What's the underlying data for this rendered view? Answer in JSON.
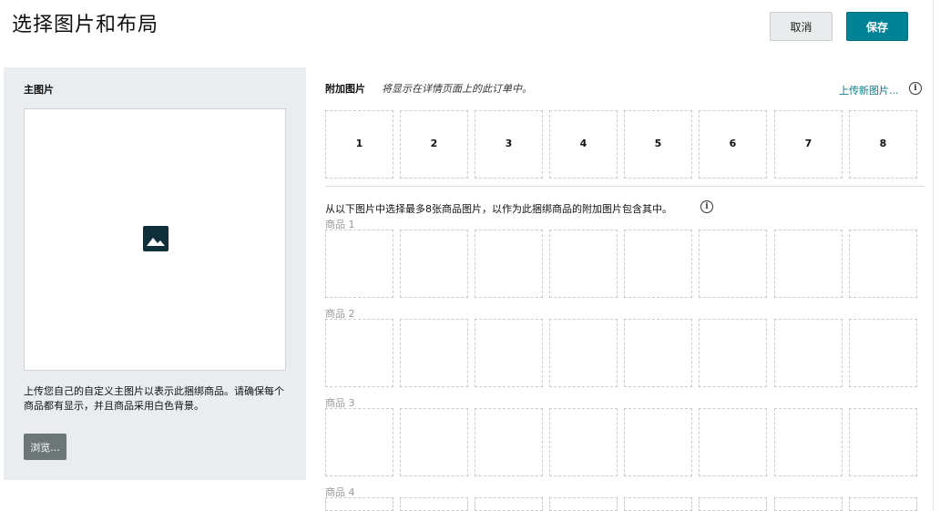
{
  "header": {
    "title": "选择图片和布局",
    "cancel_label": "取消",
    "save_label": "保存"
  },
  "main_image": {
    "label": "主图片",
    "icon": "image-icon",
    "description": "上传您自己的自定义主图片以表示此捆绑商品。请确保每个商品都有显示，并且商品采用白色背景。",
    "browse_label": "浏览..."
  },
  "additional": {
    "label": "附加图片",
    "note": "将显示在详情页面上的此订单中。",
    "upload_link": "上传新图片...",
    "slots": [
      "1",
      "2",
      "3",
      "4",
      "5",
      "6",
      "7",
      "8"
    ]
  },
  "selection": {
    "note": "从以下图片中选择最多8张商品图片，以作为此捆绑商品的附加图片包含其中。",
    "products": [
      {
        "label": "商品 1"
      },
      {
        "label": "商品 2"
      },
      {
        "label": "商品 3"
      },
      {
        "label": "商品 4"
      }
    ]
  },
  "colors": {
    "accent": "#008296",
    "link": "#0a7c8a",
    "panel_bg": "#eaedef",
    "browse_bg": "#6d7677"
  }
}
